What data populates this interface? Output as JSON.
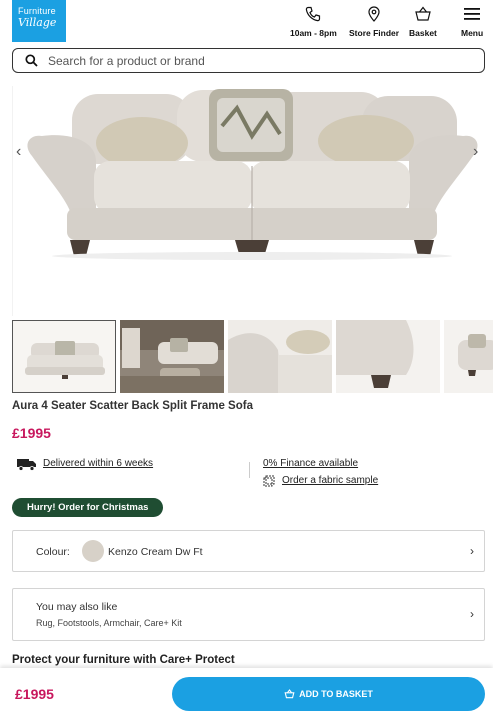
{
  "header": {
    "logo_line1": "Furniture",
    "logo_line2": "Village",
    "nav": [
      {
        "label": "10am - 8pm",
        "icon": "phone-icon"
      },
      {
        "label": "Store Finder",
        "icon": "location-pin-icon"
      },
      {
        "label": "Basket",
        "icon": "basket-icon"
      },
      {
        "label": "Menu",
        "icon": "hamburger-menu-icon"
      }
    ]
  },
  "search": {
    "placeholder": "Search for a product or brand"
  },
  "gallery": {
    "prev_arrow": "‹",
    "next_arrow": "›",
    "thumbnails": [
      "sofa-front",
      "room-scene",
      "arm-detail",
      "leg-detail",
      "side-view"
    ],
    "selected_index": 0
  },
  "product": {
    "title": "Aura 4 Seater Scatter Back Split Frame Sofa",
    "price": "£1995"
  },
  "info": {
    "delivery": "Delivered within 6 weeks",
    "finance": "0% Finance available",
    "fabric_sample": "Order a fabric sample"
  },
  "badge": "Hurry! Order for Christmas",
  "colour": {
    "label": "Colour:",
    "value": "Kenzo Cream Dw Ft",
    "swatch": "#d7d1c8"
  },
  "also_like": {
    "heading": "You may also like",
    "items": "Rug, Footstools, Armchair, Care+ Kit"
  },
  "protect": "Protect your furniture with Care+ Protect",
  "sticky": {
    "price": "£1995",
    "button": "ADD TO BASKET"
  },
  "colors": {
    "brand_blue": "#1ba0e2",
    "price_pink": "#c8175d",
    "badge_green": "#1f4d32"
  }
}
